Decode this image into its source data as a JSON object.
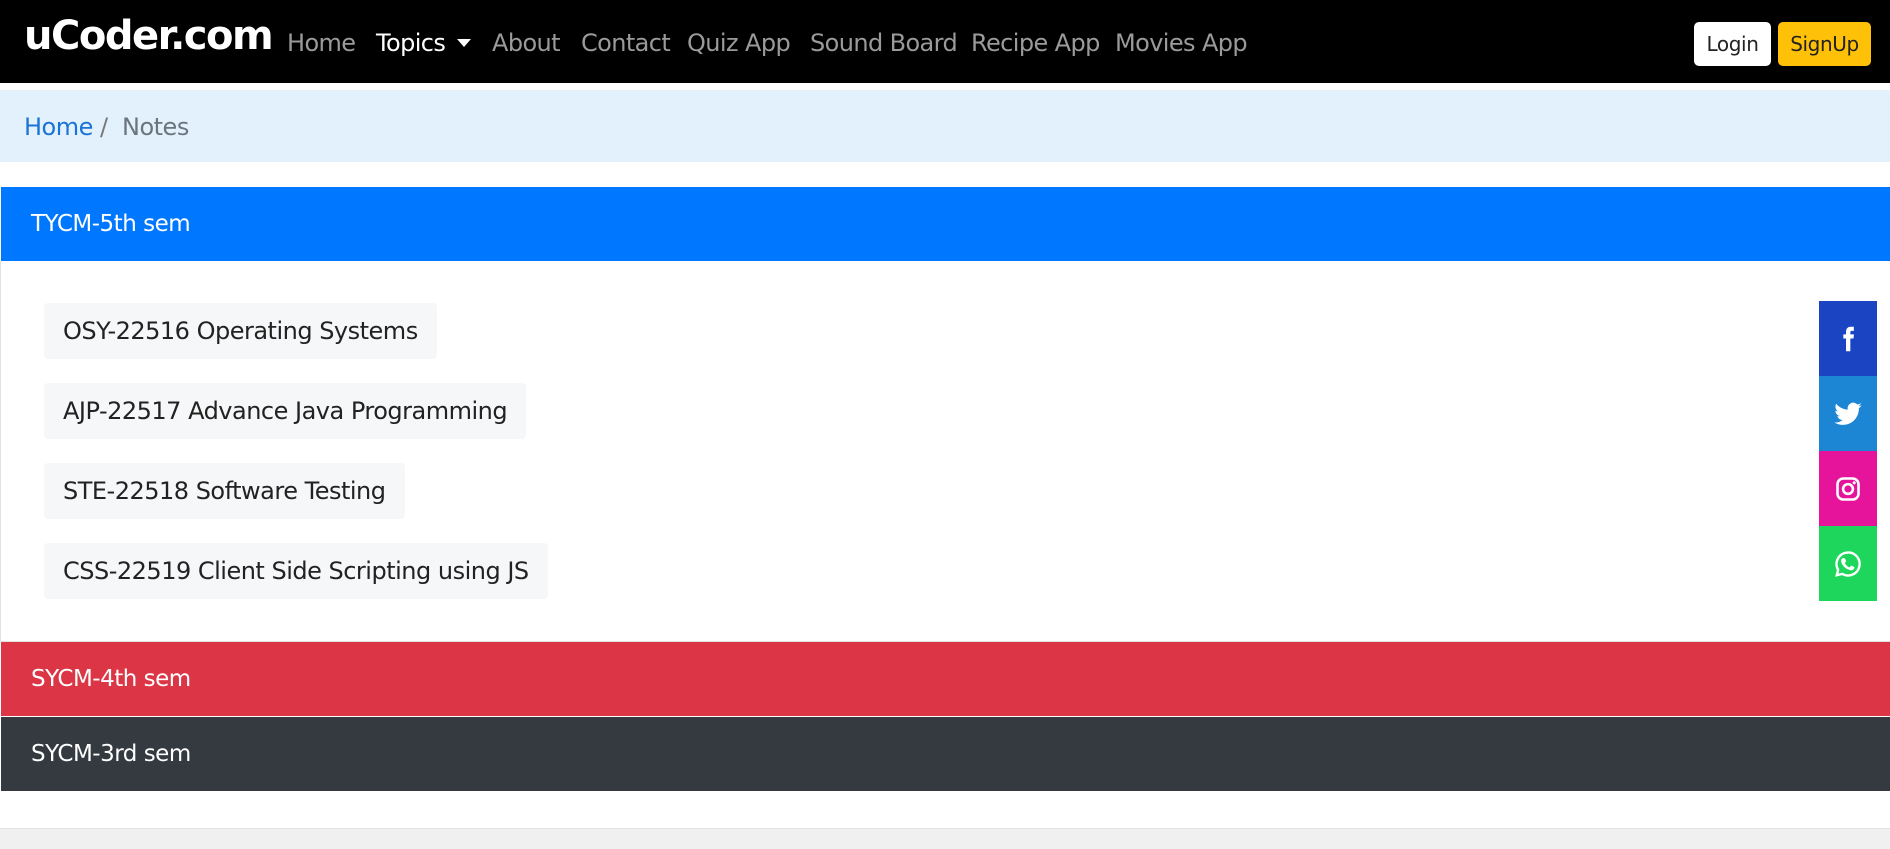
{
  "navbar": {
    "brand": "uCoder.com",
    "links": [
      {
        "label": "Home"
      },
      {
        "label": "Topics"
      },
      {
        "label": "About"
      },
      {
        "label": "Contact"
      },
      {
        "label": "Quiz App"
      },
      {
        "label": "Sound Board"
      },
      {
        "label": "Recipe App"
      },
      {
        "label": "Movies App"
      }
    ],
    "login_label": "Login",
    "signup_label": "SignUp"
  },
  "breadcrumb": {
    "home": "Home",
    "separator": "/",
    "current": "Notes"
  },
  "panels": [
    {
      "title": "TYCM-5th sem",
      "color": "#0077ff",
      "items": [
        "OSY-22516 Operating Systems",
        "AJP-22517 Advance Java Programming",
        "STE-22518 Software Testing",
        "CSS-22519 Client Side Scripting using JS"
      ]
    },
    {
      "title": "SYCM-4th sem",
      "color": "#dc3545"
    },
    {
      "title": "SYCM-3rd sem",
      "color": "#343a40"
    }
  ],
  "social": [
    {
      "icon": "facebook-icon",
      "color": "#1a44c2"
    },
    {
      "icon": "twitter-icon",
      "color": "#1d86d4"
    },
    {
      "icon": "instagram-icon",
      "color": "#e6139b"
    },
    {
      "icon": "whatsapp-icon",
      "color": "#1ed65c"
    }
  ]
}
